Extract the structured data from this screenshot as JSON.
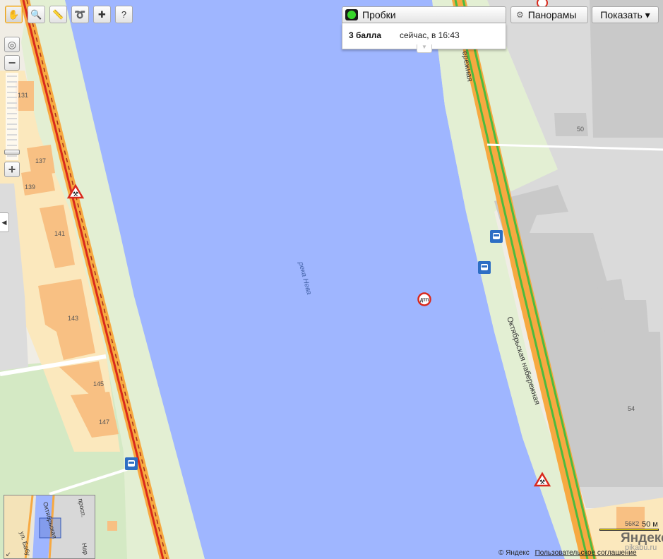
{
  "colors": {
    "water": "#9fb6ff",
    "embankment_green": "#e3efd3",
    "building_block": "#fbe8bd",
    "building": "#f8c083",
    "industrial": "#dadada",
    "road_orange": "#f7a941",
    "traffic_green": "#4dba3e",
    "traffic_red": "#d9291c",
    "park": "#d4e9c4"
  },
  "toolbar": {
    "tools": [
      {
        "name": "hand-tool",
        "icon": "hand-icon",
        "glyph": "✋",
        "active": true
      },
      {
        "name": "magnifier-tool",
        "icon": "magnifier-icon",
        "glyph": "🔍",
        "active": false
      },
      {
        "name": "ruler-tool",
        "icon": "ruler-icon",
        "glyph": "📏",
        "active": false
      },
      {
        "name": "route-tool",
        "icon": "route-icon",
        "glyph": "➰",
        "active": false
      },
      {
        "name": "add-object-tool",
        "icon": "add-object-icon",
        "glyph": "✚",
        "active": false
      },
      {
        "name": "what-here-tool",
        "icon": "cursor-question-icon",
        "glyph": "?",
        "active": false
      }
    ]
  },
  "zoom": {
    "plus": "+",
    "minus": "−",
    "level_fraction": 0.93
  },
  "traffic": {
    "button_label": "Пробки",
    "score": "3 балла",
    "time": "сейчас, в 16:43"
  },
  "panoramas_label": "Панорамы",
  "show_label": "Показать ▾",
  "map_labels": {
    "river": "река Нева",
    "embankment": "Октябрьская набережная",
    "embankment_top": "ережная",
    "buildings": [
      "131",
      "137",
      "139",
      "141",
      "143",
      "145",
      "147",
      "50",
      "54",
      "56К2"
    ]
  },
  "markers": {
    "accident": "ДТП"
  },
  "scale": {
    "label": "50 м"
  },
  "copyright": {
    "owner": "© Яндекс",
    "agreement": "Пользовательское соглашение"
  },
  "logo": "Яндекс",
  "watermark": "pikabu.ru",
  "minimap": {
    "labels": [
      "Октябрьская",
      "просп.",
      "ул. Бабу",
      "Нар"
    ]
  }
}
